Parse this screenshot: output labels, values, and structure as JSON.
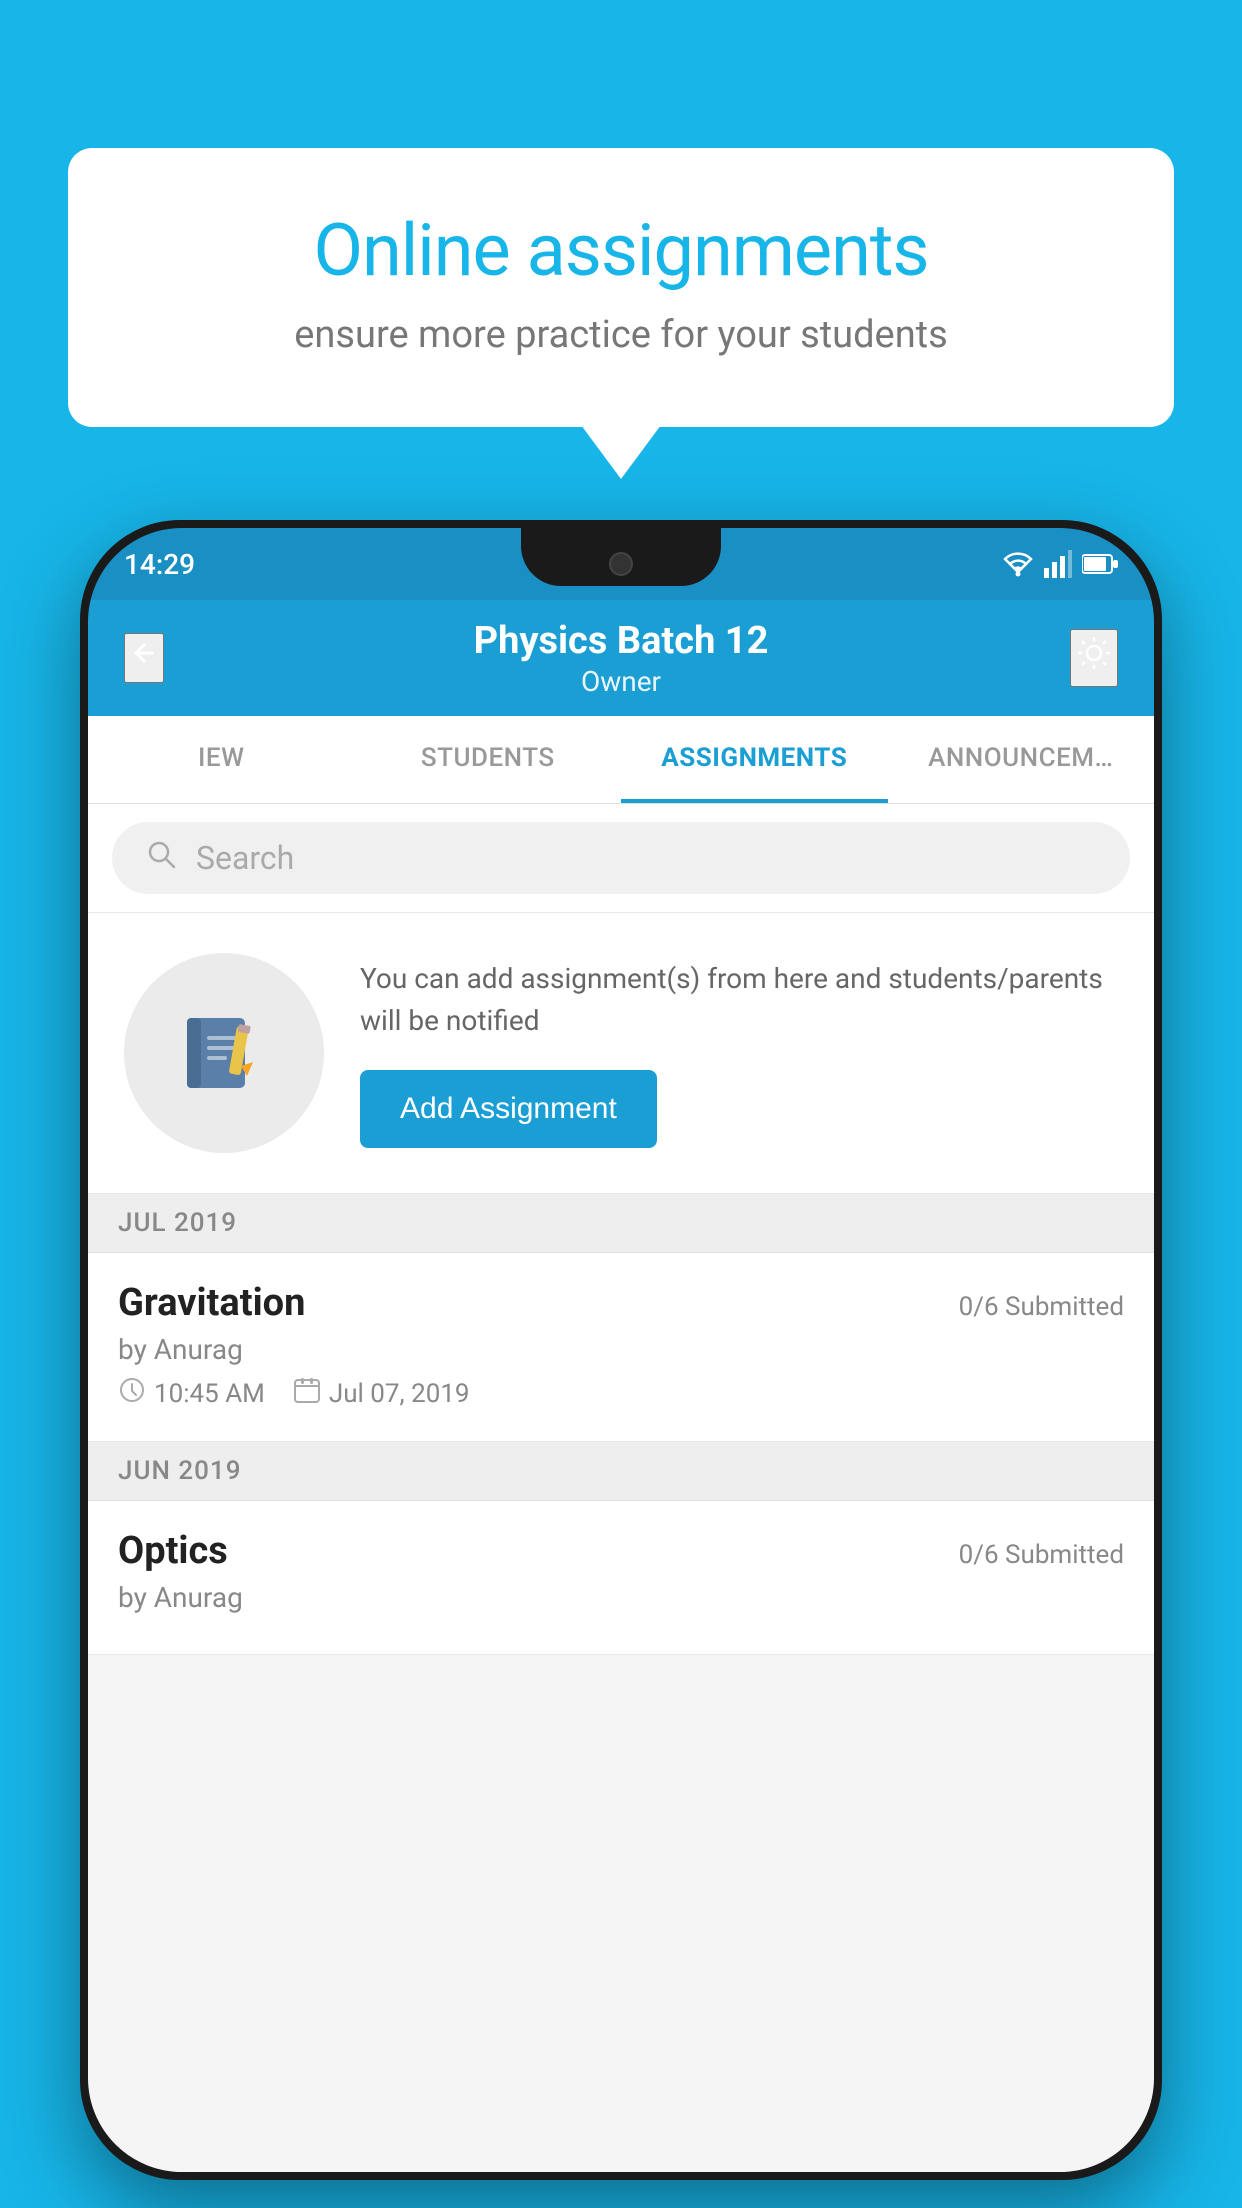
{
  "background_color": "#17b5e8",
  "speech_bubble": {
    "title": "Online assignments",
    "subtitle": "ensure more practice for your students"
  },
  "phone": {
    "status_bar": {
      "time": "14:29",
      "icons": [
        "wifi",
        "signal",
        "battery"
      ]
    },
    "header": {
      "back_label": "←",
      "title": "Physics Batch 12",
      "subtitle": "Owner",
      "settings_label": "⚙"
    },
    "tabs": [
      {
        "label": "IEW",
        "active": false
      },
      {
        "label": "STUDENTS",
        "active": false
      },
      {
        "label": "ASSIGNMENTS",
        "active": true
      },
      {
        "label": "ANNOUNCEM…",
        "active": false
      }
    ],
    "search": {
      "placeholder": "Search"
    },
    "empty_state": {
      "description": "You can add assignment(s) from here and students/parents will be notified",
      "button_label": "Add Assignment"
    },
    "sections": [
      {
        "label": "JUL 2019",
        "assignments": [
          {
            "name": "Gravitation",
            "submitted": "0/6 Submitted",
            "author": "by Anurag",
            "time": "10:45 AM",
            "date": "Jul 07, 2019"
          }
        ]
      },
      {
        "label": "JUN 2019",
        "assignments": [
          {
            "name": "Optics",
            "submitted": "0/6 Submitted",
            "author": "by Anurag",
            "time": "",
            "date": ""
          }
        ]
      }
    ]
  }
}
